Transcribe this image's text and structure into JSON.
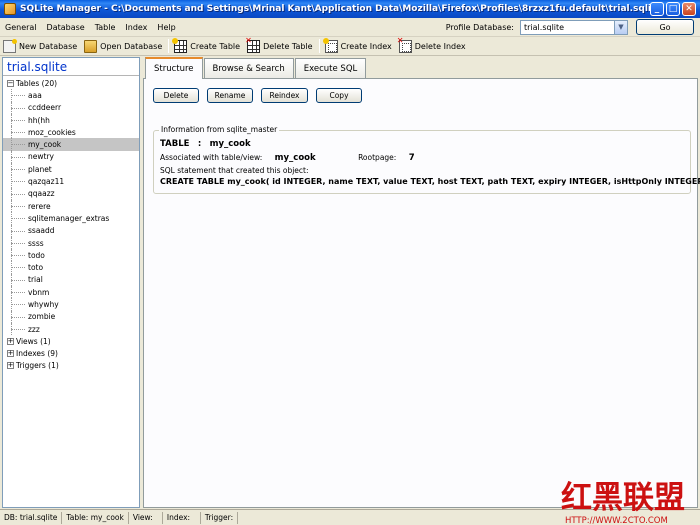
{
  "window": {
    "title": "SQLite Manager - C:\\Documents and Settings\\Mrinal Kant\\Application Data\\Mozilla\\Firefox\\Profiles\\8rzxz1fu.default\\trial.sqlite",
    "minimize": "_",
    "maximize": "□",
    "close": "✕"
  },
  "menu": {
    "items": [
      "General",
      "Database",
      "Table",
      "Index",
      "Help"
    ],
    "profile_label": "Profile Database:",
    "profile_value": "trial.sqlite",
    "go_label": "Go"
  },
  "toolbar": {
    "new_database": "New Database",
    "open_database": "Open Database",
    "create_table": "Create Table",
    "delete_table": "Delete Table",
    "create_index": "Create Index",
    "delete_index": "Delete Index"
  },
  "sidebar": {
    "db_name": "trial.sqlite",
    "tables_label": "Tables (20)",
    "tables": [
      "aaa",
      "ccddeerr",
      "hh(hh",
      "moz_cookies",
      "my_cook",
      "newtry",
      "planet",
      "qazqaz11",
      "qqaazz",
      "rerere",
      "sqlitemanager_extras",
      "ssaadd",
      "ssss",
      "todo",
      "toto",
      "trial",
      "vbnm",
      "whywhy",
      "zombie",
      "zzz"
    ],
    "selected_table": "my_cook",
    "views_label": "Views (1)",
    "indexes_label": "Indexes (9)",
    "triggers_label": "Triggers (1)",
    "expand_symbol": "+",
    "collapse_symbol": "−"
  },
  "tabs": [
    {
      "label": "Structure",
      "active": true
    },
    {
      "label": "Browse & Search",
      "active": false
    },
    {
      "label": "Execute SQL",
      "active": false
    }
  ],
  "structure": {
    "buttons": [
      "Delete",
      "Rename",
      "Reindex",
      "Copy"
    ],
    "legend": "Information from sqlite_master",
    "table_label": "TABLE",
    "separator": ":",
    "table_name": "my_cook",
    "assoc_label": "Associated with table/view:",
    "assoc_value": "my_cook",
    "rootpage_label": "Rootpage:",
    "rootpage_value": "7",
    "sql_label": "SQL statement that created this object:",
    "sql": "CREATE TABLE my_cook( id INTEGER, name TEXT, value TEXT, host TEXT, path TEXT, expiry INTEGER, isHttpOnly INTEGER )"
  },
  "status": {
    "db": "DB: trial.sqlite",
    "table": "Table: my_cook",
    "view": "View:",
    "index": "Index:",
    "trigger": "Trigger:"
  },
  "watermark": {
    "text": "红黑联盟",
    "url": "HTTP://WWW.2CTO.COM"
  },
  "colors": {
    "titlebar": "#0a56d6",
    "db_name": "#0033cc",
    "active_tab_accent": "#e68b2c",
    "watermark": "#cc1111"
  }
}
